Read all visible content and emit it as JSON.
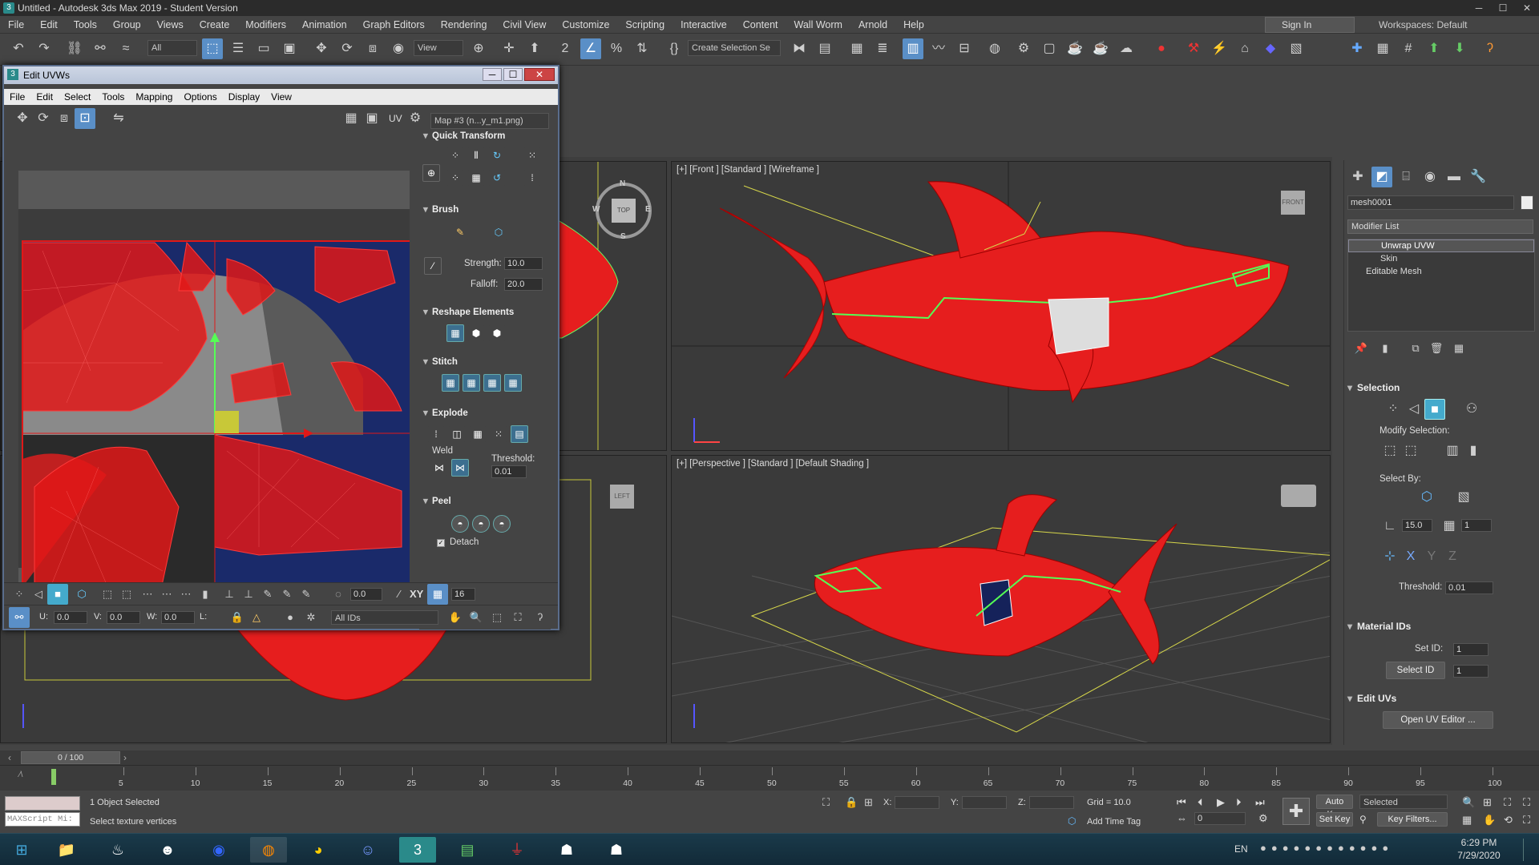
{
  "window_title": "Untitled - Autodesk 3ds Max 2019 - Student Version",
  "menu": [
    "File",
    "Edit",
    "Tools",
    "Group",
    "Views",
    "Create",
    "Modifiers",
    "Animation",
    "Graph Editors",
    "Rendering",
    "Civil View",
    "Customize",
    "Scripting",
    "Interactive",
    "Content",
    "Wall Worm",
    "Arnold",
    "Help"
  ],
  "sign_in": "Sign In",
  "workspaces_label": "Workspaces:",
  "workspace_value": "Default",
  "toolbar": {
    "filter": "All",
    "view": "View",
    "selection_set": "Create Selection Se"
  },
  "viewports": {
    "front_label": "[+] [Front ] [Standard ] [Wireframe ]",
    "persp_label": "[+] [Perspective ] [Standard ] [Default Shading ]",
    "front_cube": "FRONT",
    "top_cube": "TOP",
    "left_cube": "LEFT",
    "compass": {
      "n": "N",
      "s": "S",
      "w": "W",
      "e": "E"
    }
  },
  "cmd": {
    "object_name": "mesh0001",
    "modifier_list": "Modifier List",
    "stack": [
      "Unwrap UVW",
      "Skin",
      "Editable Mesh"
    ],
    "selection": "Selection",
    "modify_selection": "Modify Selection:",
    "select_by": "Select By:",
    "angle": "15.0",
    "step": "1",
    "threshold_label": "Threshold:",
    "threshold": "0.01",
    "material_ids": "Material IDs",
    "set_id_label": "Set ID:",
    "set_id": "1",
    "select_id": "Select ID",
    "select_id_val": "1",
    "edit_uvs": "Edit UVs",
    "open_uv_editor": "Open UV Editor ..."
  },
  "uv": {
    "title": "Edit UVWs",
    "menu": [
      "File",
      "Edit",
      "Select",
      "Tools",
      "Mapping",
      "Options",
      "Display",
      "View"
    ],
    "map": "Map #3 (n...y_m1.png)",
    "uv_label": "UV",
    "quick_transform": "Quick Transform",
    "brush": "Brush",
    "strength_label": "Strength:",
    "strength": "10.0",
    "falloff_label": "Falloff:",
    "falloff": "20.0",
    "reshape": "Reshape Elements",
    "stitch": "Stitch",
    "explode": "Explode",
    "weld": "Weld",
    "threshold_label": "Threshold:",
    "threshold": "0.01",
    "peel": "Peel",
    "detach": "Detach",
    "rot_val": "0.0",
    "xy": "XY",
    "grid_val": "16",
    "u_label": "U:",
    "u": "0.0",
    "v_label": "V:",
    "v": "0.0",
    "w_label": "W:",
    "w": "0.0",
    "l_label": "L:",
    "ids": "All IDs"
  },
  "timeline": {
    "frame": "0 / 100",
    "ticks": [
      "5",
      "10",
      "15",
      "20",
      "25",
      "30",
      "35",
      "40",
      "45",
      "50",
      "55",
      "60",
      "65",
      "70",
      "75",
      "80",
      "85",
      "90",
      "95",
      "100"
    ]
  },
  "status": {
    "selected": "1 Object Selected",
    "prompt": "Select texture vertices",
    "maxscript": "MAXScript Mi:",
    "x_label": "X:",
    "y_label": "Y:",
    "z_label": "Z:",
    "grid": "Grid = 10.0",
    "add_time_tag": "Add Time Tag",
    "auto_key": "Auto Key",
    "selected_dd": "Selected",
    "set_key": "Set Key",
    "key_filters": "Key Filters...",
    "frame": "0"
  },
  "taskbar": {
    "lang": "EN",
    "time": "6:29 PM",
    "date": "7/29/2020"
  }
}
